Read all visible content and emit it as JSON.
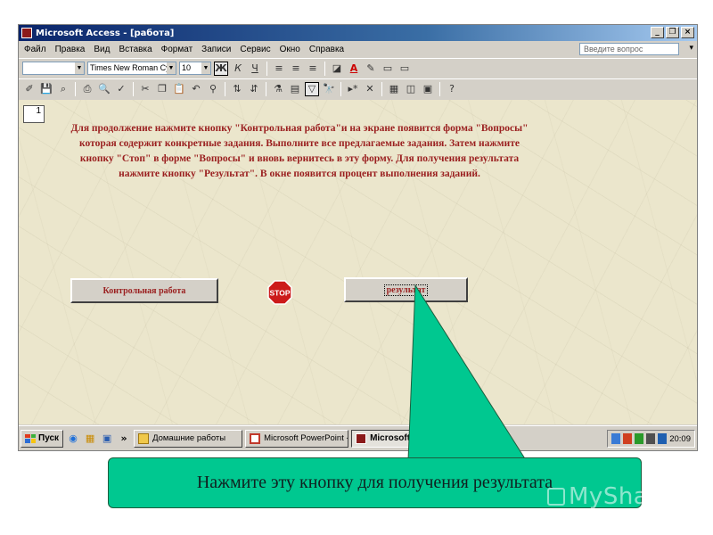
{
  "window": {
    "title": "Microsoft Access - [работа]",
    "controls": [
      "_",
      "×"
    ]
  },
  "menubar": {
    "items": [
      "Файл",
      "Правка",
      "Вид",
      "Вставка",
      "Формат",
      "Записи",
      "Сервис",
      "Окно",
      "Справка"
    ],
    "ask_placeholder": "Введите вопрос"
  },
  "format_toolbar": {
    "object_combo": "",
    "font": "Times New Roman Cyr",
    "size": "10",
    "bold": "Ж",
    "italic": "К",
    "underline": "Ч"
  },
  "form": {
    "page_number": "1",
    "instruction": "Для продолжение нажмите кнопку \"Контрольная работа\"и на экране появится форма \"Вопросы\" которая содержит конкретные задания. Выполните все предлагаемые задания. Затем нажмите кнопку \"Стоп\" в форме \"Вопросы\" и вновь вернитесь в эту форму. Для получения результата нажмите кнопку \"Результат\". В окне появится процент выполнения заданий.",
    "button_test": "Контрольная работа",
    "button_stop": "STOP",
    "button_result": "результат"
  },
  "taskbar": {
    "start": "Пуск",
    "chevron": "»",
    "tasks": [
      "Домашние работы",
      "Microsoft PowerPoint - [...",
      "Microsoft Access - ["
    ],
    "clock": "20:09"
  },
  "callout": {
    "text": "Нажмите эту кнопку для получения результата",
    "color": "#00c890"
  },
  "watermark": {
    "text": "MyShared"
  },
  "colors": {
    "form_text": "#9a1f1f",
    "title_bar": "#0a246a",
    "form_bg": "#ebe6cc",
    "stop_sign": "#cc1a1a"
  }
}
